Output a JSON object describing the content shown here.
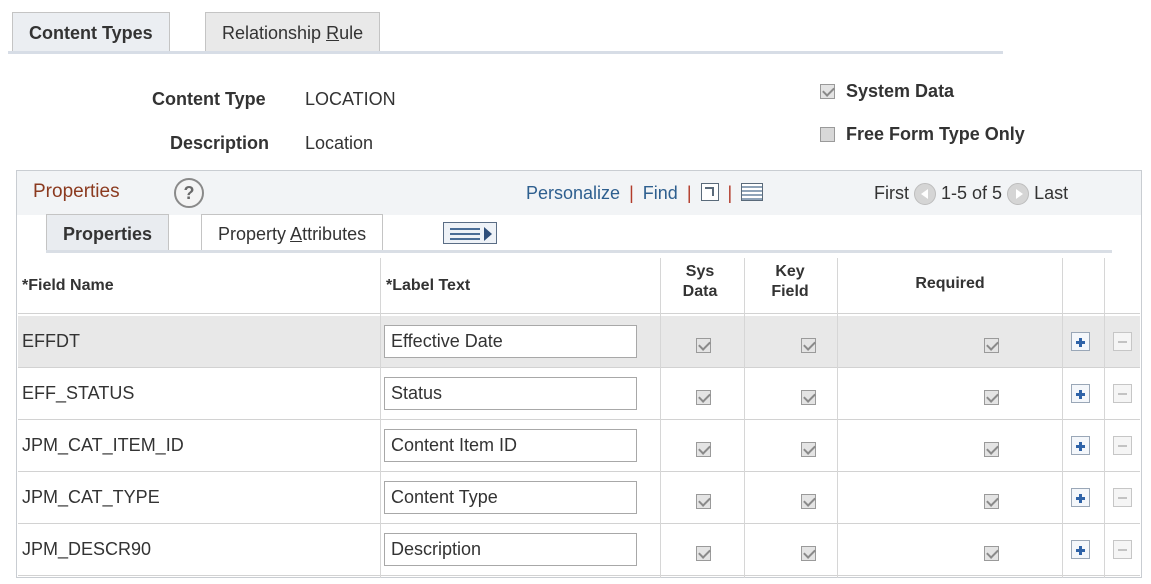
{
  "tabs": [
    {
      "label_pre": "Content Types",
      "label_ul": "",
      "label_post": ""
    },
    {
      "label_pre": "Relationship ",
      "label_ul": "R",
      "label_post": "ule"
    }
  ],
  "header": {
    "content_type_label": "Content Type",
    "content_type_value": "LOCATION",
    "description_label": "Description",
    "description_value": "Location",
    "system_data_label": "System Data",
    "system_data_checked": true,
    "free_form_label": "Free Form Type Only",
    "free_form_checked": false
  },
  "grid": {
    "title": "Properties",
    "help": "?",
    "personalize": "Personalize",
    "find": "Find",
    "sep": "|",
    "first": "First",
    "range": "1-5 of 5",
    "last": "Last",
    "subtabs": [
      {
        "label_pre": "Properties",
        "label_ul": "",
        "label_post": ""
      },
      {
        "label_pre": "Property ",
        "label_ul": "A",
        "label_post": "ttributes"
      }
    ],
    "columns": {
      "field_name": "*Field Name",
      "label_text": "*Label Text",
      "sys_data_1": "Sys",
      "sys_data_2": "Data",
      "key_field_1": "Key",
      "key_field_2": "Field",
      "required": "Required"
    },
    "rows": [
      {
        "field": "EFFDT",
        "label": "Effective Date",
        "sys": true,
        "key": true,
        "req": true
      },
      {
        "field": "EFF_STATUS",
        "label": "Status",
        "sys": true,
        "key": true,
        "req": true
      },
      {
        "field": "JPM_CAT_ITEM_ID",
        "label": "Content Item ID",
        "sys": true,
        "key": true,
        "req": true
      },
      {
        "field": "JPM_CAT_TYPE",
        "label": "Content Type",
        "sys": true,
        "key": true,
        "req": true
      },
      {
        "field": "JPM_DESCR90",
        "label": "Description",
        "sys": true,
        "key": true,
        "req": true
      }
    ]
  },
  "colors": {
    "grid_title": "#8b3a1f",
    "link": "#2e5f8f",
    "add_icon": "#2f63a8"
  }
}
